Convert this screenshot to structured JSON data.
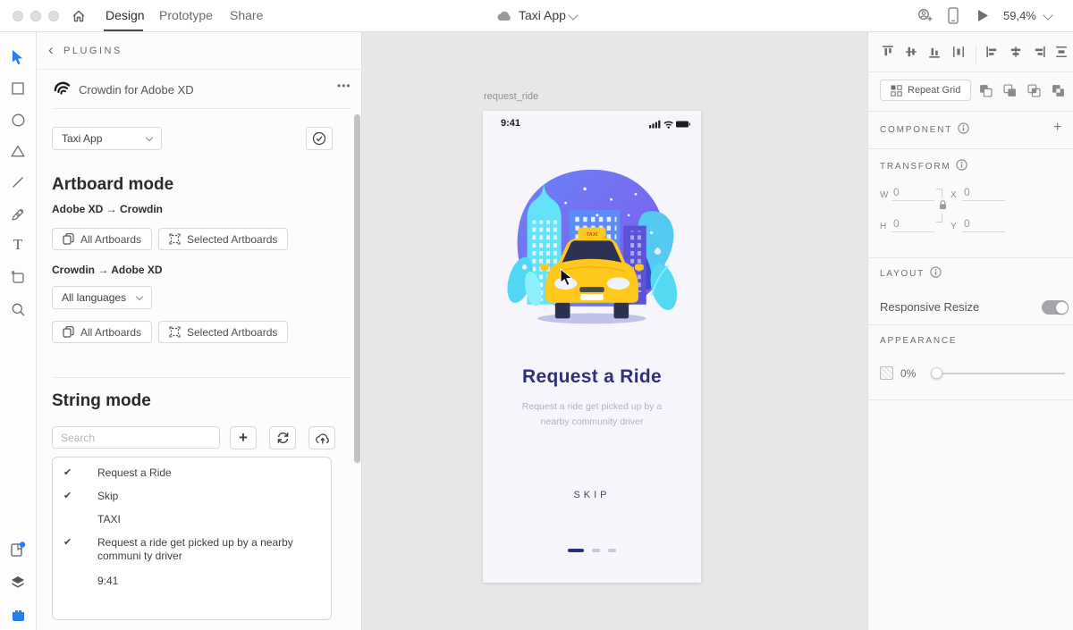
{
  "topbar": {
    "tabs": [
      {
        "label": "Design"
      },
      {
        "label": "Prototype"
      },
      {
        "label": "Share"
      }
    ],
    "document_title": "Taxi App",
    "zoom_level": "59,4%"
  },
  "icons": {
    "ellipsis": "•••",
    "text_tool": "T",
    "back_chevron": "‹",
    "plus": "+"
  },
  "plugin_panel": {
    "header": "PLUGINS",
    "plugin_title": "Crowdin for Adobe XD",
    "project_select": "Taxi App",
    "artboard_mode": {
      "title": "Artboard mode",
      "xd_to_crowdin": "Adobe XD → Crowdin",
      "crowdin_to_xd": "Crowdin → Adobe XD",
      "all_artboards": "All Artboards",
      "selected_artboards": "Selected Artboards",
      "languages_select": "All languages"
    },
    "string_mode": {
      "title": "String mode",
      "search_placeholder": "Search",
      "strings": [
        {
          "mark": "✔",
          "text": "Request a Ride"
        },
        {
          "mark": "✔",
          "text": "Skip"
        },
        {
          "mark": "",
          "text": "TAXI"
        },
        {
          "mark": "✔",
          "text": "Request a ride get picked up by a nearby communi ty driver"
        },
        {
          "mark": "",
          "text": "9:41"
        }
      ]
    }
  },
  "canvas": {
    "artboard_name": "request_ride",
    "phone": {
      "status_time": "9:41",
      "taxi_sign": "TAXI",
      "title": "Request a Ride",
      "subtitle_line1": "Request a ride get picked up by a",
      "subtitle_line2": "nearby community driver",
      "skip": "SKIP"
    }
  },
  "right_panel": {
    "repeat_grid": "Repeat Grid",
    "component": "COMPONENT",
    "transform": "TRANSFORM",
    "w_label": "W",
    "h_label": "H",
    "x_label": "X",
    "y_label": "Y",
    "w_value": "0",
    "h_value": "0",
    "x_value": "0",
    "y_value": "0",
    "layout": "LAYOUT",
    "responsive_resize": "Responsive Resize",
    "appearance": "APPEARANCE",
    "opacity_value": "0%"
  },
  "colors": {
    "accent_blue": "#2680eb",
    "title_indigo": "#2f3178",
    "taxi_yellow": "#ffc81a",
    "illustration_cyan": "#5fdcf8",
    "pager_active": "#2f3178",
    "pager_inactive": "#c9c8d6"
  }
}
